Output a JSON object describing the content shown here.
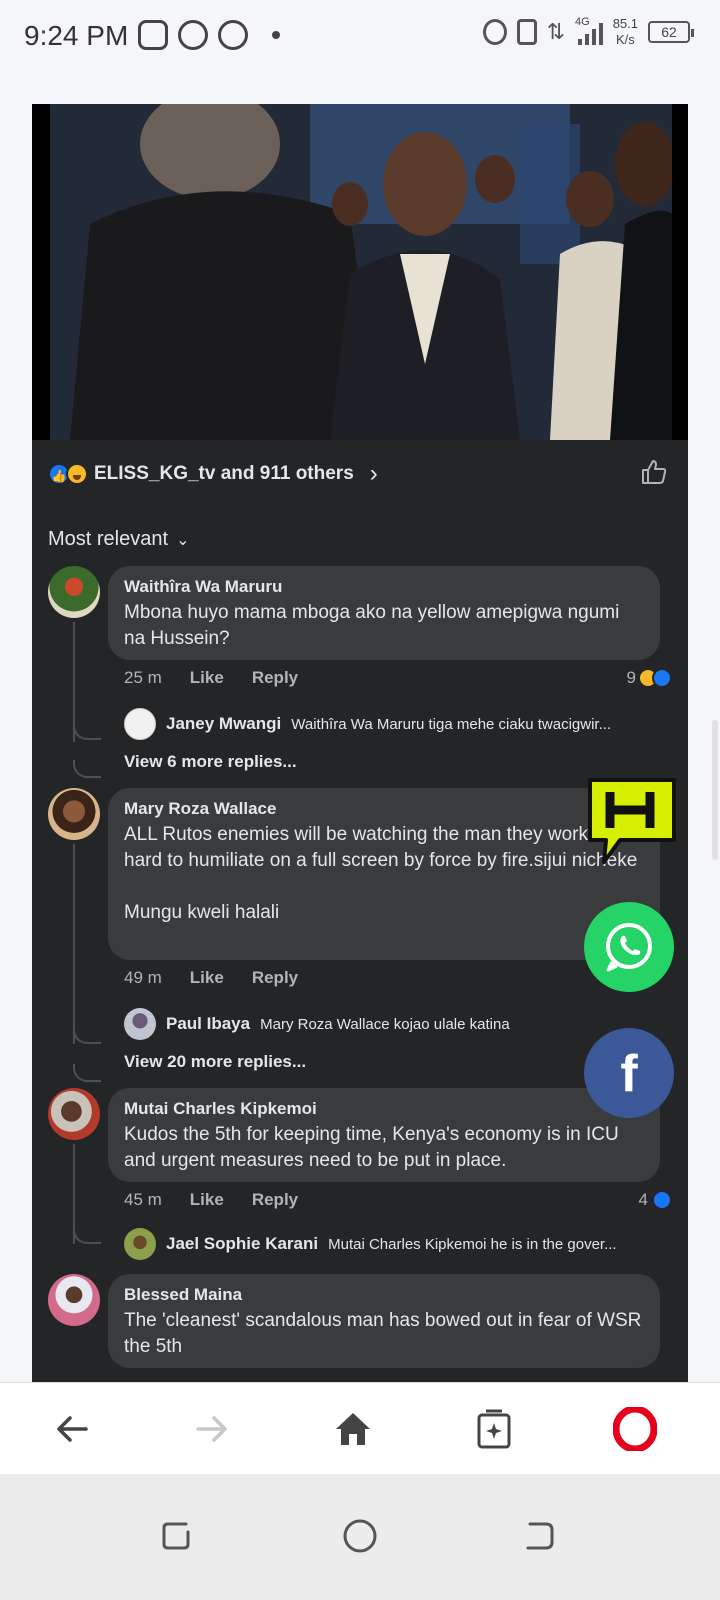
{
  "status_bar": {
    "time": "9:24 PM",
    "network": "4G",
    "speed_value": "85.1",
    "speed_unit": "K/s",
    "battery": "62"
  },
  "post": {
    "reactions_summary": "ELISS_KG_tv and 911 others",
    "sort_label": "Most relevant"
  },
  "comments": [
    {
      "name": "Waithîra Wa Maruru",
      "text": "Mbona huyo mama mboga ako na yellow amepigwa ngumi na Hussein?",
      "time": "25 m",
      "like": "Like",
      "reply": "Reply",
      "reaction_count": "9",
      "reply_preview": {
        "name": "Janey Mwangi",
        "text": "Waithîra Wa Maruru tiga mehe ciaku twacigwir..."
      },
      "view_more": "View 6 more replies..."
    },
    {
      "name": "Mary Roza Wallace",
      "text": "ALL Rutos enemies will be watching the man they worked so hard to humiliate on a full screen by force by fire.sijui nicheke\n\nMungu kweli halali",
      "time": "49 m",
      "like": "Like",
      "reply": "Reply",
      "reaction_count": "",
      "reply_preview": {
        "name": "Paul Ibaya",
        "text": "Mary Roza Wallace kojao ulale katina"
      },
      "view_more": "View 20 more replies..."
    },
    {
      "name": "Mutai Charles Kipkemoi",
      "text": "Kudos the 5th for keeping time, Kenya's economy is in ICU and urgent measures need to be put in place.",
      "time": "45 m",
      "like": "Like",
      "reply": "Reply",
      "reaction_count": "4",
      "reply_preview": {
        "name": "Jael Sophie Karani",
        "text": "Mutai Charles Kipkemoi he is in the gover..."
      },
      "view_more": ""
    },
    {
      "name": "Blessed Maina",
      "text": "The 'cleanest' scandalous man has bowed out in fear of WSR the 5th",
      "time": "",
      "like": "",
      "reply": "",
      "reaction_count": ""
    }
  ],
  "share": {
    "facebook_glyph": "f"
  },
  "colors": {
    "card_bg": "#242526",
    "bubble_bg": "#3a3b3c",
    "like_blue": "#1877f2",
    "whatsapp_green": "#25d366",
    "facebook_blue": "#3b5998",
    "opera_red": "#e5001c",
    "tuko_yellow": "#d6f000"
  },
  "icons": {
    "back": "arrow-left-icon",
    "forward": "arrow-right-icon",
    "home": "home-icon",
    "tabs": "tabs-icon",
    "browser_menu": "opera-logo-icon"
  }
}
